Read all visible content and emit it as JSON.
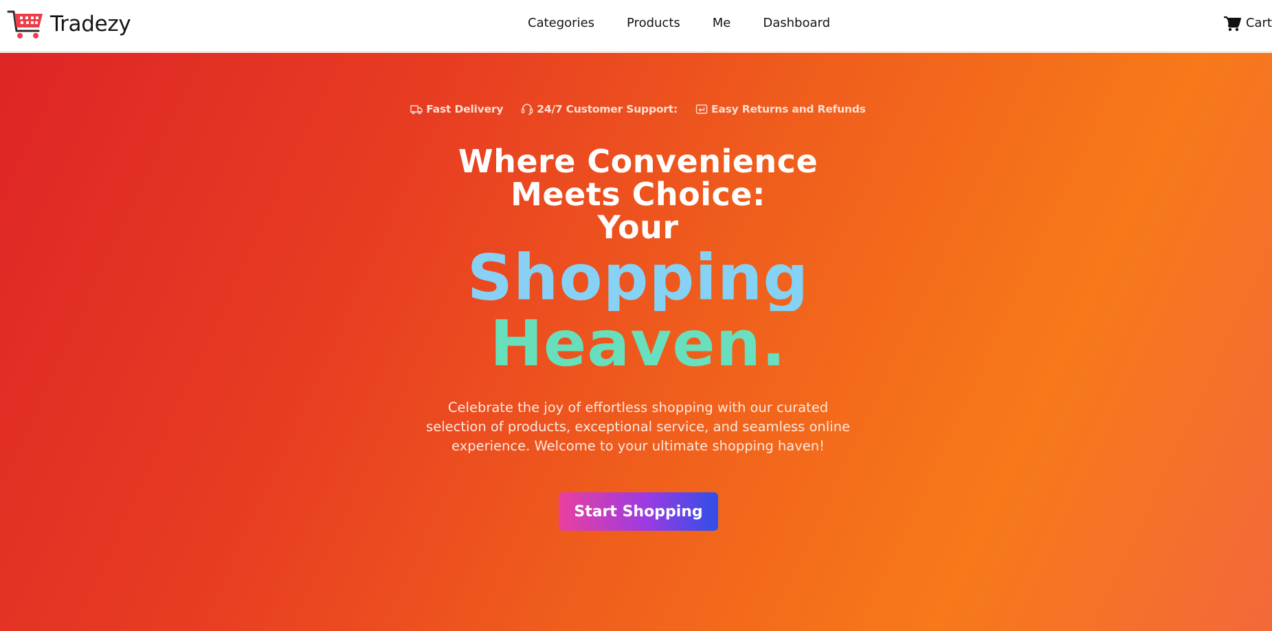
{
  "brand": {
    "name": "Tradezy",
    "logo_icon": "shopping-cart-logo"
  },
  "nav": {
    "links": [
      {
        "label": "Categories"
      },
      {
        "label": "Products"
      },
      {
        "label": "Me"
      },
      {
        "label": "Dashboard"
      }
    ],
    "cart_label": "Cart",
    "cart_icon": "cart-icon"
  },
  "hero": {
    "features": [
      {
        "label": "Fast Delivery",
        "icon": "truck-icon"
      },
      {
        "label": "24/7 Customer Support:",
        "icon": "headset-icon"
      },
      {
        "label": "Easy Returns and Refunds",
        "icon": "return-icon"
      }
    ],
    "headline_line1": "Where Convenience",
    "headline_line2": "Meets Choice:",
    "headline_line3": "Your",
    "headline_highlight1": "Shopping",
    "headline_highlight2": "Heaven.",
    "subtitle": "Celebrate the joy of effortless shopping with our curated selection of products, exceptional service, and seamless online experience. Welcome to your ultimate shopping haven!",
    "cta_label": "Start Shopping"
  },
  "colors": {
    "hero_gradient_start": "#de2526",
    "hero_gradient_end": "#f7791a",
    "highlight_blue": "#8ecff6",
    "highlight_green": "#64dcb1",
    "cta_gradient_start": "#e9409f",
    "cta_gradient_mid": "#9b3be2",
    "cta_gradient_end": "#2f4fe8"
  }
}
